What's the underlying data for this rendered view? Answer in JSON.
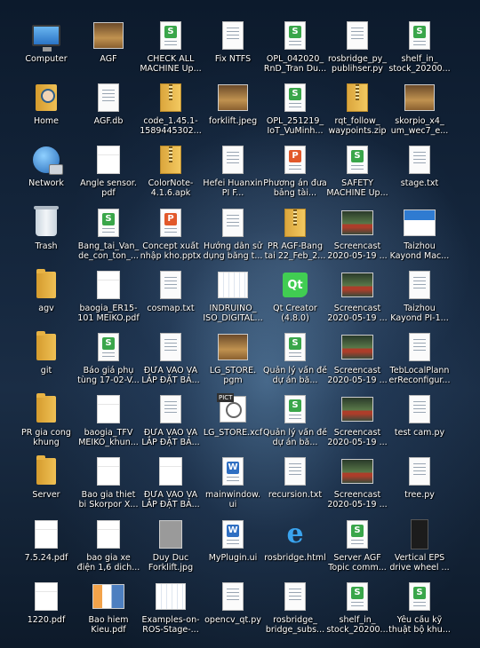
{
  "desktop": {
    "icons": [
      {
        "label": "Computer",
        "icon": "computer-icon"
      },
      {
        "label": "AGF",
        "icon": "image-thumbnail-icon"
      },
      {
        "label": "CHECK ALL MACHINE Up...",
        "icon": "spreadsheet-icon"
      },
      {
        "label": "Fix NTFS",
        "icon": "text-file-icon"
      },
      {
        "label": "OPL_042020_ RnD_Tran Du...",
        "icon": "spreadsheet-icon"
      },
      {
        "label": "rosbridge_py_ publihser.py",
        "icon": "text-file-icon"
      },
      {
        "label": "shelf_in_ stock_20200...",
        "icon": "spreadsheet-icon"
      },
      {
        "label": "Home",
        "icon": "home-folder-icon"
      },
      {
        "label": "AGF.db",
        "icon": "text-file-icon"
      },
      {
        "label": "code_1.45.1- 1589445302...",
        "icon": "archive-icon"
      },
      {
        "label": "forklift.jpeg",
        "icon": "image-thumbnail-icon"
      },
      {
        "label": "OPL_251219_ IoT_VuMinh...",
        "icon": "spreadsheet-icon"
      },
      {
        "label": "rqt_follow_ waypoints.zip",
        "icon": "archive-icon"
      },
      {
        "label": "skorpio_x4_ um_wec7_e...",
        "icon": "image-thumbnail-icon"
      },
      {
        "label": "Network",
        "icon": "network-icon"
      },
      {
        "label": "Angle sensor. pdf",
        "icon": "pdf-thumbnail-icon"
      },
      {
        "label": "ColorNote- 4.1.6.apk",
        "icon": "archive-icon"
      },
      {
        "label": "Hefei Huanxin PI F...",
        "icon": "text-file-icon"
      },
      {
        "label": "Phương án đưa bảng tài...",
        "icon": "presentation-icon"
      },
      {
        "label": "SAFETY MACHINE Up...",
        "icon": "spreadsheet-icon"
      },
      {
        "label": "stage.txt",
        "icon": "text-file-icon"
      },
      {
        "label": "Trash",
        "icon": "trash-icon"
      },
      {
        "label": "Bang_tai_Van_ de_con_ton_...",
        "icon": "spreadsheet-icon"
      },
      {
        "label": "Concept xuất nhập kho.pptx",
        "icon": "presentation-icon"
      },
      {
        "label": "Hướng dẫn sử dụng băng t...",
        "icon": "text-file-icon"
      },
      {
        "label": "PR AGF-Bang tai 22_Feb_2...",
        "icon": "archive-icon"
      },
      {
        "label": "Screencast 2020-05-19 ...",
        "icon": "video-thumbnail-icon"
      },
      {
        "label": "Taizhou Kayond Mac...",
        "icon": "banner-thumbnail-icon"
      },
      {
        "label": "agv",
        "icon": "folder-icon"
      },
      {
        "label": "baogia_ER15- 101 MEIKO.pdf",
        "icon": "pdf-thumbnail-icon"
      },
      {
        "label": "cosmap.txt",
        "icon": "text-file-icon"
      },
      {
        "label": "INDRUINO_ ISO_DIGITAL...",
        "icon": "plan-thumbnail-icon"
      },
      {
        "label": "Qt Creator (4.8.0)",
        "icon": "qt-creator-icon"
      },
      {
        "label": "Screencast 2020-05-19 ...",
        "icon": "video-thumbnail-icon"
      },
      {
        "label": "Taizhou Kayond PI-1...",
        "icon": "text-file-icon"
      },
      {
        "label": "git",
        "icon": "folder-icon"
      },
      {
        "label": "Báo giá phụ tùng 17-02-V...",
        "icon": "spreadsheet-icon"
      },
      {
        "label": "ĐƯA VÀO VÀ LẮP ĐẶT BẢ...",
        "icon": "text-file-icon"
      },
      {
        "label": "LG_STORE. pgm",
        "icon": "image-thumbnail-icon"
      },
      {
        "label": "Quản lý vấn đề dự án bă...",
        "icon": "spreadsheet-icon"
      },
      {
        "label": "Screencast 2020-05-19 ...",
        "icon": "video-thumbnail-icon"
      },
      {
        "label": "TebLocalPlann erReconfigur...",
        "icon": "text-file-icon"
      },
      {
        "label": "PR gia cong khung",
        "icon": "folder-icon"
      },
      {
        "label": "baogia_TFV MEIKO_khun...",
        "icon": "pdf-thumbnail-icon"
      },
      {
        "label": "ĐƯA VÀO VÀ LẮP ĐẶT BẢ...",
        "icon": "text-file-icon"
      },
      {
        "label": "LG_STORE.xcf",
        "icon": "xcf-image-icon"
      },
      {
        "label": "Quản lý vấn đề dự án bă...",
        "icon": "spreadsheet-icon"
      },
      {
        "label": "Screencast 2020-05-19 ...",
        "icon": "video-thumbnail-icon"
      },
      {
        "label": "test cam.py",
        "icon": "text-file-icon"
      },
      {
        "label": "Server",
        "icon": "folder-icon"
      },
      {
        "label": "Bao gia thiet bi Skorpor X...",
        "icon": "pdf-thumbnail-icon"
      },
      {
        "label": "ĐƯA VÀO VÀ LẮP ĐẶT BẢ...",
        "icon": "pdf-thumbnail-icon"
      },
      {
        "label": "mainwindow. ui",
        "icon": "word-document-icon"
      },
      {
        "label": "recursion.txt",
        "icon": "text-file-icon"
      },
      {
        "label": "Screencast 2020-05-19 ...",
        "icon": "video-thumbnail-icon"
      },
      {
        "label": "tree.py",
        "icon": "text-file-icon"
      },
      {
        "label": "7.5.24.pdf",
        "icon": "pdf-thumbnail-icon"
      },
      {
        "label": "bao gia xe điện 1,6 dich...",
        "icon": "pdf-thumbnail-icon"
      },
      {
        "label": "Duy Duc Forklift.jpg",
        "icon": "gray-thumbnail-icon"
      },
      {
        "label": "MyPlugin.ui",
        "icon": "word-document-icon"
      },
      {
        "label": "rosbridge.html",
        "icon": "browser-html-icon"
      },
      {
        "label": "Server AGF Topic comm...",
        "icon": "spreadsheet-icon"
      },
      {
        "label": "Vertical EPS drive wheel ...",
        "icon": "dark-thumbnail-icon"
      },
      {
        "label": "1220.pdf",
        "icon": "pdf-thumbnail-icon"
      },
      {
        "label": "Bao hiem Kieu.pdf",
        "icon": "mixed-thumbnail-icon"
      },
      {
        "label": "Examples-on- ROS-Stage-...",
        "icon": "plan-thumbnail-icon"
      },
      {
        "label": "opencv_qt.py",
        "icon": "text-file-icon"
      },
      {
        "label": "rosbridge_ bridge_subs...",
        "icon": "text-file-icon"
      },
      {
        "label": "shelf_in_ stock_20200...",
        "icon": "spreadsheet-icon"
      },
      {
        "label": "Yêu cầu kỹ thuật bộ khu...",
        "icon": "spreadsheet-icon"
      }
    ]
  }
}
